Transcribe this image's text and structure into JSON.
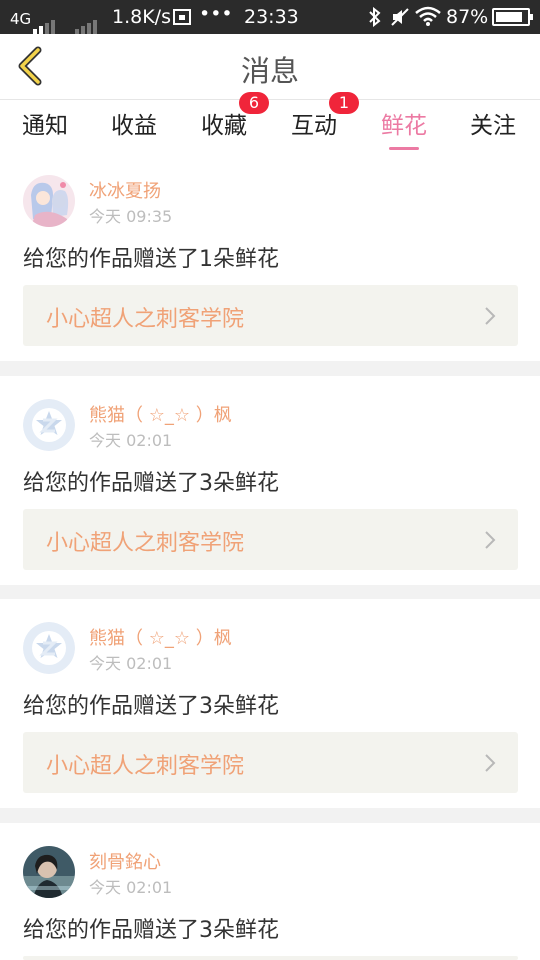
{
  "status_bar": {
    "network": "4G",
    "speed": "1.8K/s",
    "overflow": "•••",
    "time": "23:33",
    "battery": "87%",
    "battery_level": 0.87,
    "icons": [
      "signal-icon",
      "screenshot-icon",
      "bluetooth-icon",
      "mute-icon",
      "wifi-icon",
      "battery-icon"
    ]
  },
  "header": {
    "title": "消息",
    "back_icon": "chevron-left-icon"
  },
  "tabs": [
    {
      "label": "通知",
      "badge": ""
    },
    {
      "label": "收益",
      "badge": ""
    },
    {
      "label": "收藏",
      "badge": "6"
    },
    {
      "label": "互动",
      "badge": "1"
    },
    {
      "label": "鲜花",
      "badge": "",
      "active": true
    },
    {
      "label": "关注",
      "badge": ""
    }
  ],
  "colors": {
    "accent": "#ec7aa3",
    "badge": "#f0253a",
    "name": "#f0a277"
  },
  "messages": [
    {
      "name": "冰冰夏扬",
      "time": "今天 09:35",
      "text": "给您的作品赠送了1朵鲜花",
      "work": "小心超人之刺客学院",
      "avatar": "anime-avatar"
    },
    {
      "name": "熊猫（ ☆_☆ ）枫",
      "time": "今天 02:01",
      "text": "给您的作品赠送了3朵鲜花",
      "work": "小心超人之刺客学院",
      "avatar": "default-avatar"
    },
    {
      "name": "熊猫（ ☆_☆ ）枫",
      "time": "今天 02:01",
      "text": "给您的作品赠送了3朵鲜花",
      "work": "小心超人之刺客学院",
      "avatar": "default-avatar"
    },
    {
      "name": "刻骨銘心",
      "time": "今天 02:01",
      "text": "给您的作品赠送了3朵鲜花",
      "work": "",
      "avatar": "photo-avatar"
    }
  ]
}
